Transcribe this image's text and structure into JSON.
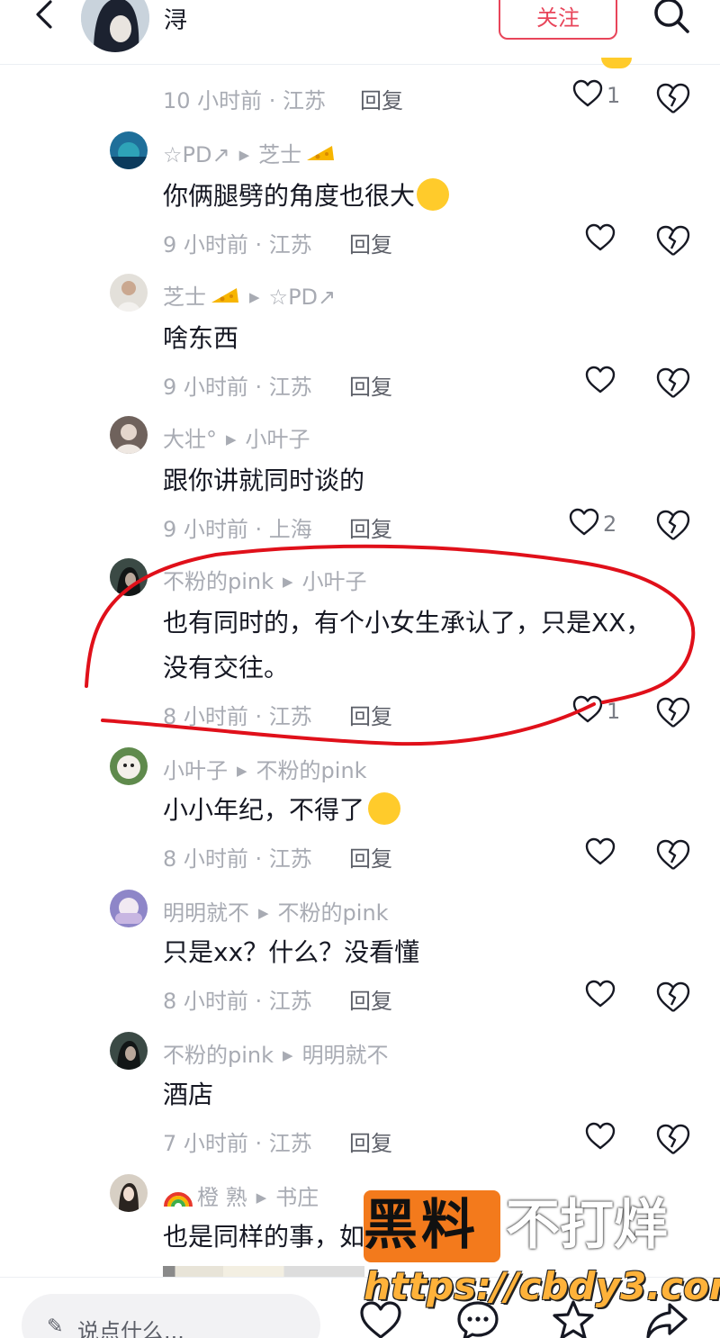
{
  "header": {
    "author_name": "浔",
    "follow_label": "关注"
  },
  "comments": [
    {
      "meta": "10 小时前 · 江苏",
      "reply": "回复",
      "likes": "1"
    },
    {
      "user": "☆PD↗",
      "to": "芝士",
      "text": "你俩腿劈的角度也很大",
      "meta": "9 小时前 · 江苏",
      "reply": "回复",
      "likes": ""
    },
    {
      "user": "芝士",
      "to": "☆PD↗",
      "text": "啥东西",
      "meta": "9 小时前 · 江苏",
      "reply": "回复",
      "likes": ""
    },
    {
      "user": "大壮°",
      "to": "小叶子",
      "text": "跟你讲就同时谈的",
      "meta": "9 小时前 · 上海",
      "reply": "回复",
      "likes": "2"
    },
    {
      "user": "不粉的pink",
      "to": "小叶子",
      "text_line1": "也有同时的，有个小女生承认了，只是XX，",
      "text_line2": "没有交往。",
      "meta": "8 小时前 · 江苏",
      "reply": "回复",
      "likes": "1"
    },
    {
      "user": "小叶子",
      "to": "不粉的pink",
      "text": "小小年纪，不得了",
      "meta": "8 小时前 · 江苏",
      "reply": "回复",
      "likes": ""
    },
    {
      "user": "明明就不",
      "to": "不粉的pink",
      "text": "只是xx？什么？没看懂",
      "meta": "8 小时前 · 江苏",
      "reply": "回复",
      "likes": ""
    },
    {
      "user": "不粉的pink",
      "to": "明明就不",
      "text": "酒店",
      "meta": "7 小时前 · 江苏",
      "reply": "回复",
      "likes": ""
    },
    {
      "user": "橙  熟",
      "to": "书庄",
      "text": "也是同样的事，如"
    }
  ],
  "bottom": {
    "input_placeholder": "说点什么..."
  },
  "watermark": {
    "black_text": "黑料",
    "white_text": "不打烊",
    "url": "https://cbdy3.com"
  },
  "colors": {
    "accent": "#e8455a",
    "secondary_text": "#a8abb3",
    "annotation_circle": "#e0101a",
    "watermark_orange": "#f37a1c"
  }
}
